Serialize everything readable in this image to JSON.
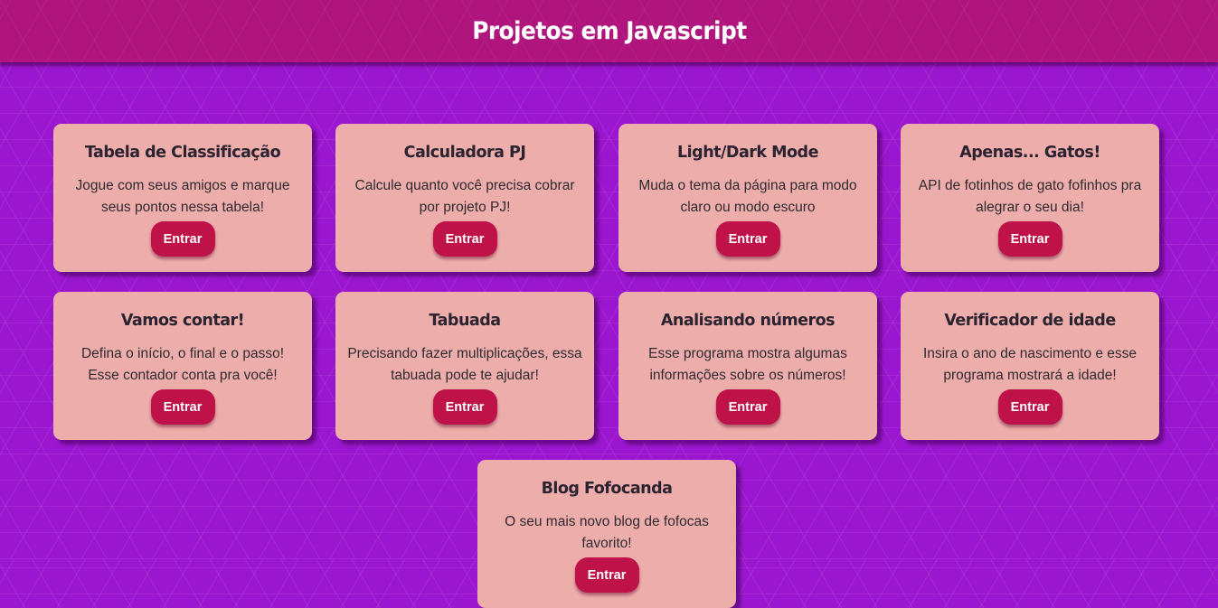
{
  "header": {
    "title": "Projetos em Javascript"
  },
  "cards": [
    {
      "title": "Tabela de Classificação",
      "description": "Jogue com seus amigos e marque seus pontos nessa tabela!",
      "button_label": "Entrar"
    },
    {
      "title": "Calculadora PJ",
      "description": "Calcule quanto você precisa cobrar por projeto PJ!",
      "button_label": "Entrar"
    },
    {
      "title": "Light/Dark Mode",
      "description": "Muda o tema da página para modo claro ou modo escuro",
      "button_label": "Entrar"
    },
    {
      "title": "Apenas... Gatos!",
      "description": "API de fotinhos de gato fofinhos pra alegrar o seu dia!",
      "button_label": "Entrar"
    },
    {
      "title": "Vamos contar!",
      "description": "Defina o início, o final e o passo! Esse contador conta pra você!",
      "button_label": "Entrar"
    },
    {
      "title": "Tabuada",
      "description": "Precisando fazer multiplicações, essa tabuada pode te ajudar!",
      "button_label": "Entrar"
    },
    {
      "title": "Analisando números",
      "description": "Esse programa mostra algumas informações sobre os números!",
      "button_label": "Entrar"
    },
    {
      "title": "Verificador de idade",
      "description": "Insira o ano de nascimento e esse programa mostrará a idade!",
      "button_label": "Entrar"
    },
    {
      "title": "Blog Fofocanda",
      "description": "O seu mais novo blog de fofocas favorito!",
      "button_label": "Entrar"
    }
  ],
  "colors": {
    "background": "#9b17cf",
    "header": "#b0157e",
    "card": "#edadab",
    "button": "#be1248"
  }
}
